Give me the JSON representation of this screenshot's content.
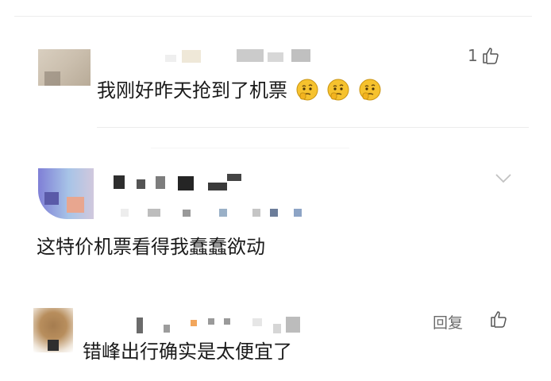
{
  "comments": [
    {
      "text": "我刚好昨天抢到了机票",
      "emoji_icons": [
        "thinking-face-icon",
        "thinking-face-icon",
        "thinking-face-icon"
      ],
      "like_count": "1"
    },
    {
      "text": "这特价机票看得我蠢蠢欲动",
      "action_icon": "chevron-down-icon"
    },
    {
      "text": "错峰出行确实是太便宜了",
      "reply_label": "回复",
      "action_icon": "thumbs-up-icon"
    }
  ],
  "colors": {
    "text": "#1b1b1b",
    "muted": "#6b6b6b",
    "divider": "#ececec",
    "emoji_yellow": "#f6c22e"
  }
}
